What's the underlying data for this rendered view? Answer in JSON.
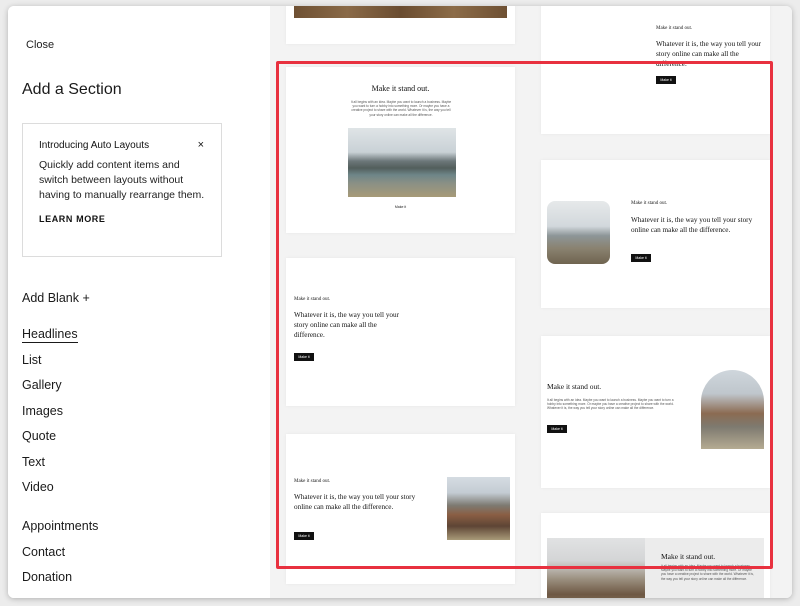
{
  "sidebar": {
    "close_label": "Close",
    "title": "Add a Section",
    "intro_card": {
      "title": "Introducing Auto Layouts",
      "close_icon": "×",
      "body": "Quickly add content items and switch between layouts without having to manually rearrange them.",
      "link": "LEARN MORE"
    },
    "add_blank": "Add Blank +",
    "categories": [
      "Headlines",
      "List",
      "Gallery",
      "Images",
      "Quote",
      "Text",
      "Video"
    ],
    "active_category": "Headlines",
    "categories_2": [
      "Appointments",
      "Contact",
      "Donation"
    ]
  },
  "previews": {
    "headline": "Make it stand out.",
    "body": "Whatever it is, the way you tell your story online can make all the difference.",
    "button": "Make it",
    "paragraph": "It all begins with an idea. Maybe you want to launch a business. Maybe you want to turn a hobby into something more. Or maybe you have a creative project to share with the world. Whatever it is, the way you tell your story online can make all the difference."
  },
  "colors": {
    "highlight": "#e8313f",
    "accent": "#111111"
  }
}
